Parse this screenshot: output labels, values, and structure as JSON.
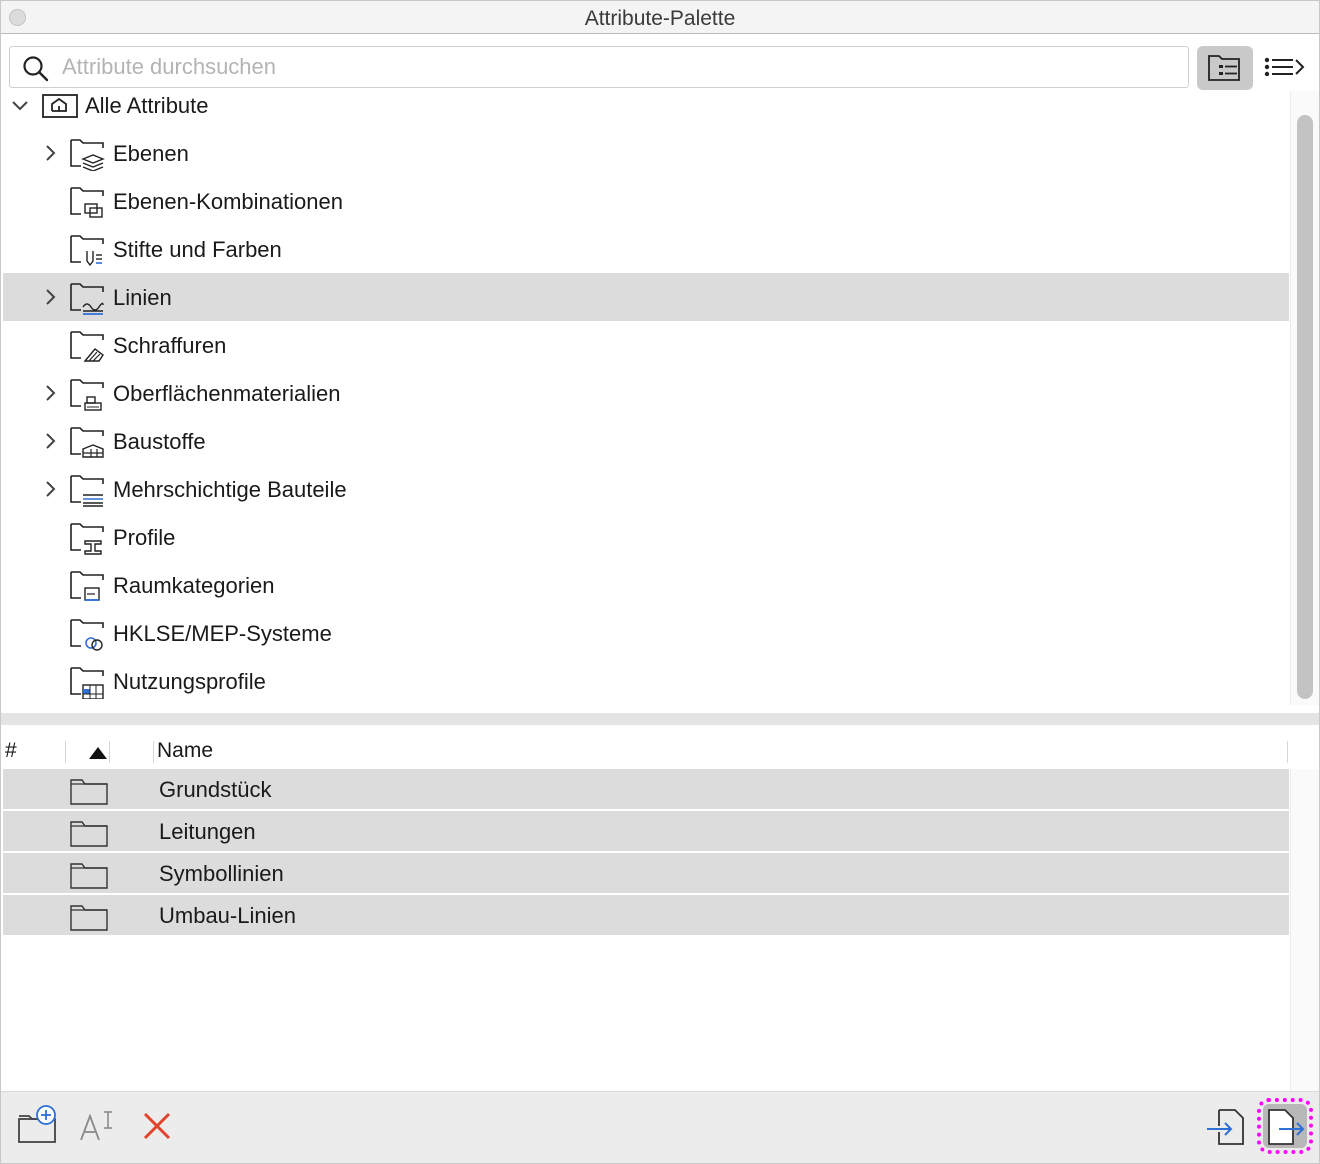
{
  "window": {
    "title": "Attribute-Palette"
  },
  "search": {
    "placeholder": "Attribute durchsuchen",
    "value": ""
  },
  "view_toggle": {
    "active": "tree",
    "buttons": [
      "tree-view-icon",
      "list-view-icon"
    ]
  },
  "tree": {
    "root": {
      "label": "Alle Attribute",
      "expanded": true,
      "icon": "house-folder-icon"
    },
    "items": [
      {
        "label": "Ebenen",
        "expandable": true,
        "icon": "layers-folder-icon",
        "selected": false
      },
      {
        "label": "Ebenen-Kombinationen",
        "expandable": false,
        "icon": "layer-combinations-folder-icon",
        "selected": false
      },
      {
        "label": "Stifte und Farben",
        "expandable": false,
        "icon": "pens-folder-icon",
        "selected": false
      },
      {
        "label": "Linien",
        "expandable": true,
        "icon": "lines-folder-icon",
        "selected": true
      },
      {
        "label": "Schraffuren",
        "expandable": false,
        "icon": "fills-folder-icon",
        "selected": false
      },
      {
        "label": "Oberflächenmaterialien",
        "expandable": true,
        "icon": "surfaces-folder-icon",
        "selected": false
      },
      {
        "label": "Baustoffe",
        "expandable": true,
        "icon": "building-materials-folder-icon",
        "selected": false
      },
      {
        "label": "Mehrschichtige Bauteile",
        "expandable": true,
        "icon": "composites-folder-icon",
        "selected": false
      },
      {
        "label": "Profile",
        "expandable": false,
        "icon": "profiles-folder-icon",
        "selected": false
      },
      {
        "label": "Raumkategorien",
        "expandable": false,
        "icon": "zone-categories-folder-icon",
        "selected": false
      },
      {
        "label": "HKLSE/MEP-Systeme",
        "expandable": false,
        "icon": "mep-systems-folder-icon",
        "selected": false
      },
      {
        "label": "Nutzungsprofile",
        "expandable": false,
        "icon": "operation-profiles-folder-icon",
        "selected": false
      }
    ]
  },
  "list": {
    "columns": {
      "number": "#",
      "name": "Name"
    },
    "sort": "ascending",
    "rows": [
      {
        "name": "Grundstück",
        "icon": "folder-icon"
      },
      {
        "name": "Leitungen",
        "icon": "folder-icon"
      },
      {
        "name": "Symbollinien",
        "icon": "folder-icon"
      },
      {
        "name": "Umbau-Linien",
        "icon": "folder-icon"
      }
    ]
  },
  "footer": {
    "left_buttons": [
      "new-folder-icon",
      "rename-icon",
      "delete-icon"
    ],
    "right_buttons": [
      "import-icon",
      "export-icon"
    ],
    "highlighted": "export-icon"
  },
  "colors": {
    "selection": "#dcdcdc",
    "accent_blue": "#2f6fd6",
    "delete_red": "#e2432a",
    "highlight_marker": "#ff00ff"
  }
}
